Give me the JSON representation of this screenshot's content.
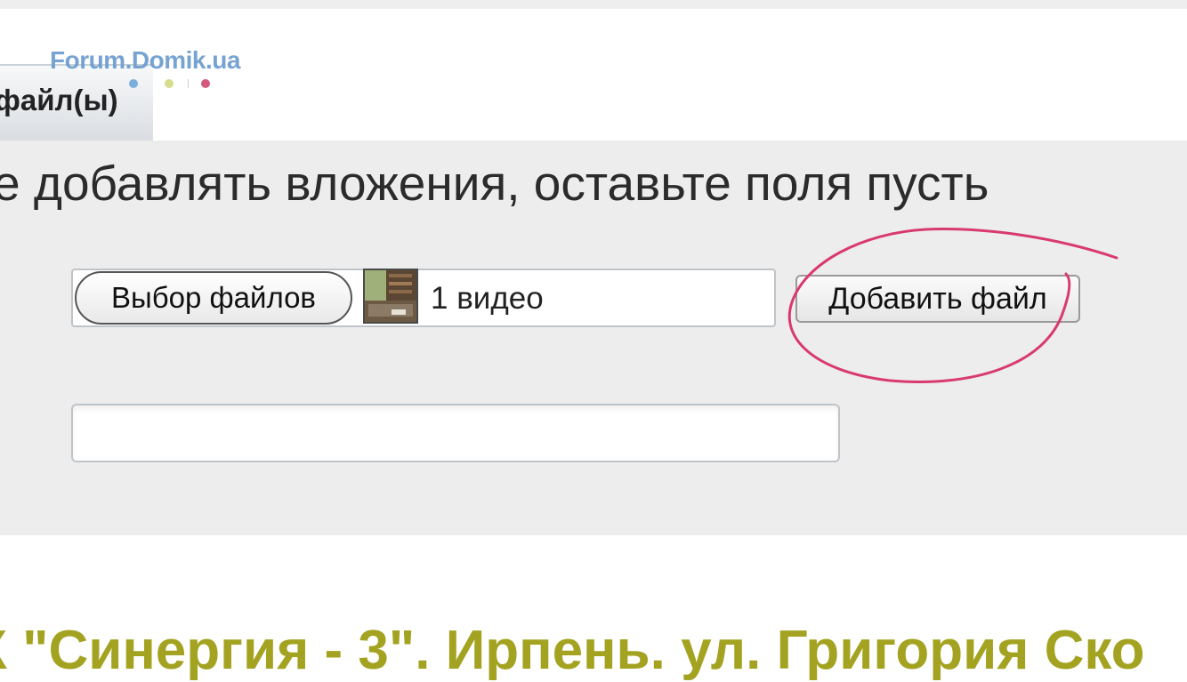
{
  "watermark": {
    "text": "Forum.Domik.ua",
    "dot_colors": [
      "#7aaedc",
      "#d4de8c",
      "#d4587c"
    ]
  },
  "tab": {
    "label": "файл(ы)"
  },
  "attachments": {
    "instruction": "е добавлять вложения, оставьте поля пусть",
    "choose_button_label": "Выбор файлов",
    "selected_file": "1 видео",
    "add_button_label": "Добавить файл",
    "text_field_value": ""
  },
  "topic_title": "К \"Синергия - 3\". Ирпень. ул. Григория Ско",
  "colors": {
    "panel_bg": "#ededed",
    "highlight_circle": "#d93a6e",
    "title": "#a3a321"
  },
  "icons": {
    "thumbnail": "video-thumbnail-icon"
  }
}
